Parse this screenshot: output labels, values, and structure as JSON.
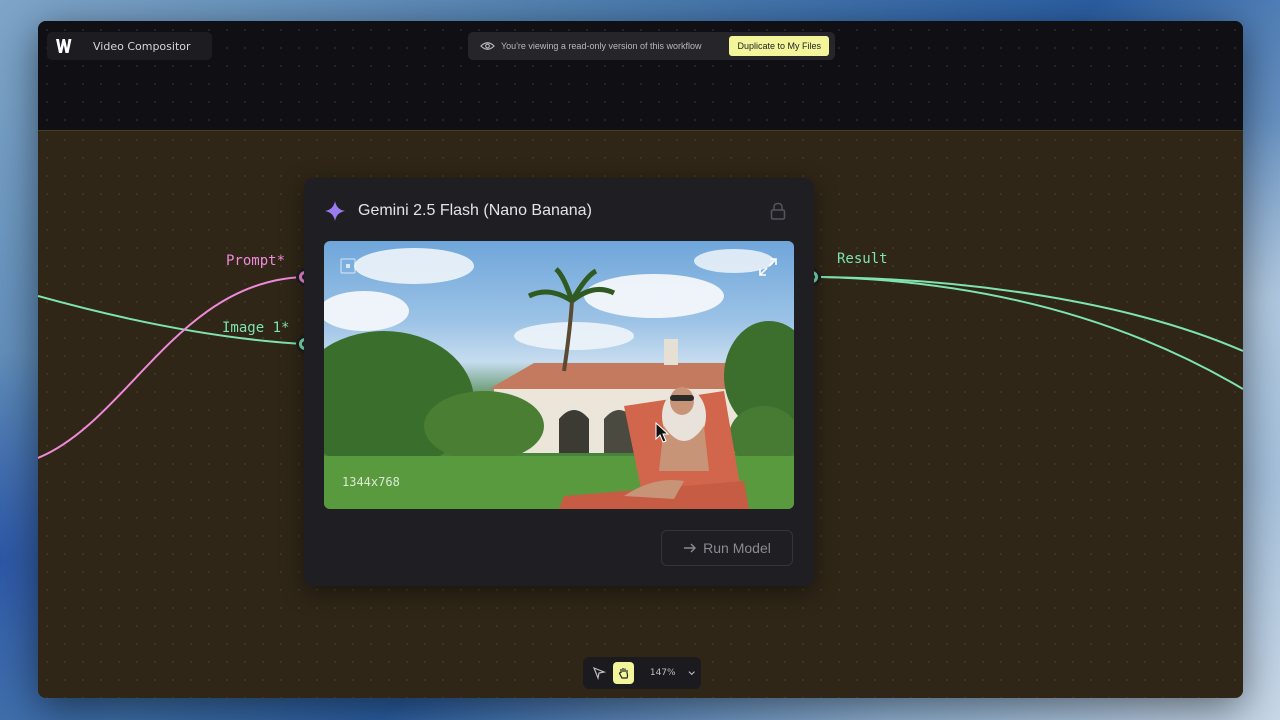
{
  "app": {
    "title": "Video Compositor"
  },
  "banner": {
    "text": "You're viewing a read-only version of this workflow",
    "duplicate_label": "Duplicate to My Files"
  },
  "node": {
    "title": "Gemini 2.5 Flash (Nano Banana)",
    "image_dims": "1344x768",
    "run_label": "Run Model",
    "inputs": [
      {
        "label": "Prompt*",
        "color": "#f08ad8"
      },
      {
        "label": "Image 1*",
        "color": "#7fe3b0"
      }
    ],
    "output": {
      "label": "Result",
      "color": "#7fe3b0"
    }
  },
  "toolbar": {
    "zoom": "147%"
  },
  "colors": {
    "accent_yellow": "#f2f59a",
    "prompt_wire": "#f08ad8",
    "image_wire": "#7fe3b0",
    "canvas_bg": "#2f2617",
    "node_bg": "#1f1f23"
  }
}
